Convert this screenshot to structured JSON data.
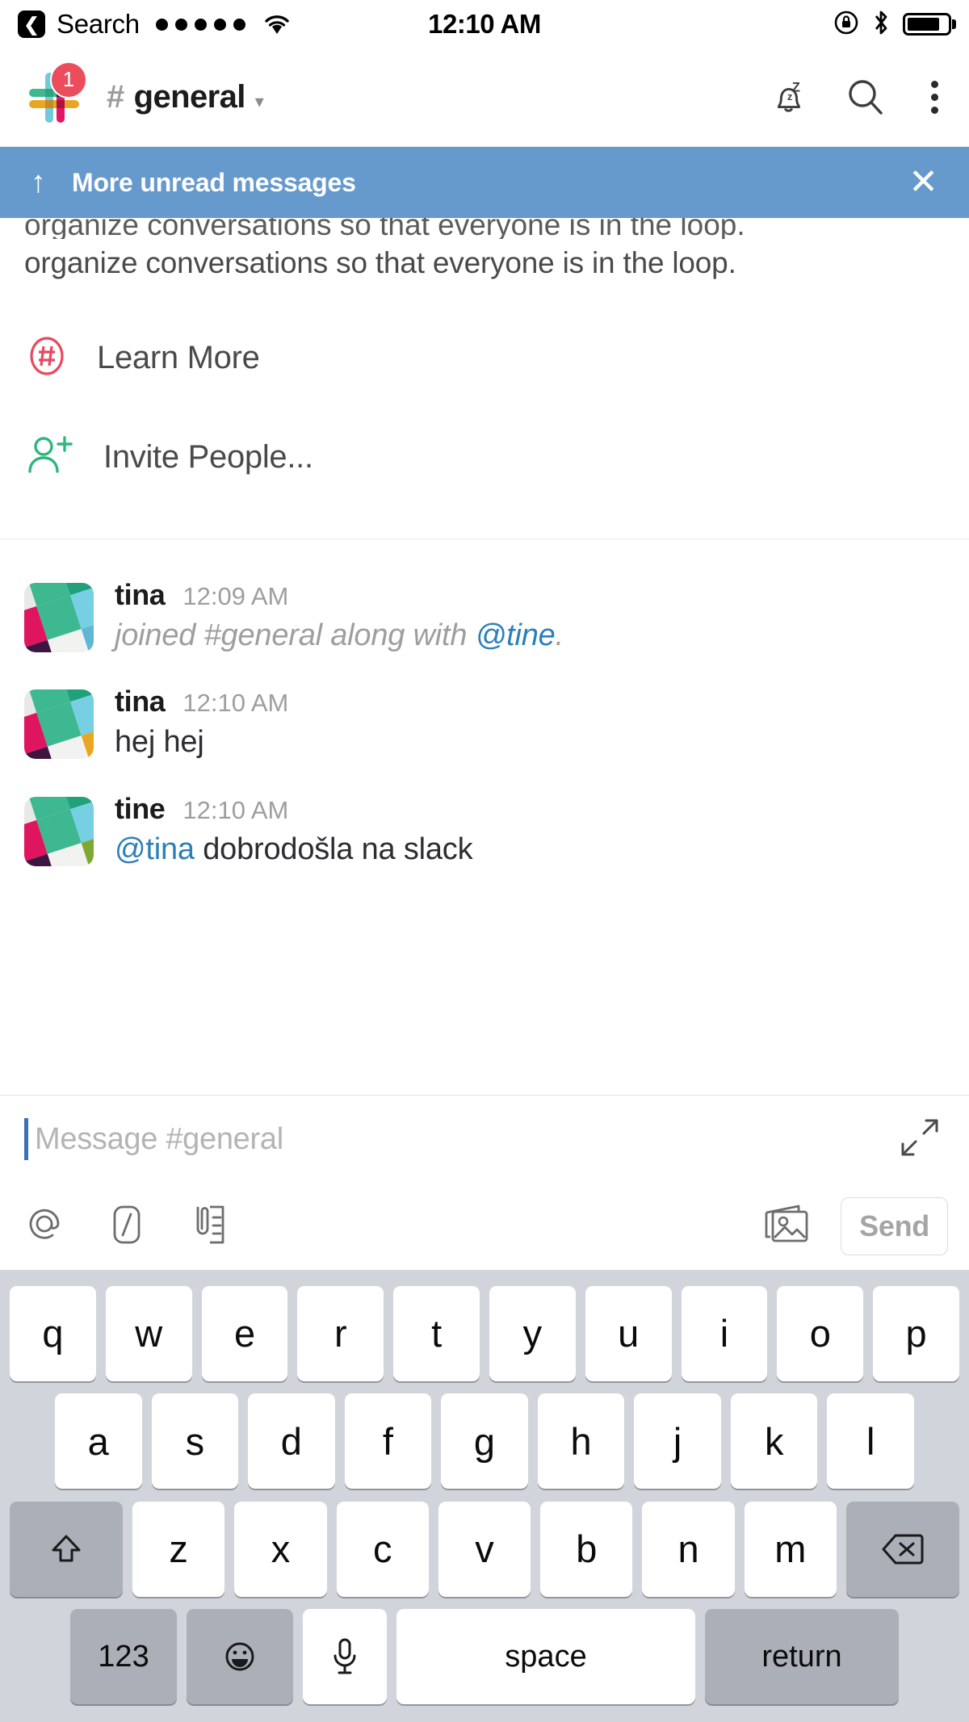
{
  "status_bar": {
    "back_icon": "back-chevron-icon",
    "carrier_label": "Search",
    "signal_icon": "signal-dots-icon",
    "wifi_icon": "wifi-icon",
    "time": "12:10 AM",
    "rotation_lock_icon": "rotation-lock-icon",
    "bluetooth_icon": "bluetooth-icon",
    "battery_icon": "battery-icon"
  },
  "nav_bar": {
    "logo_icon": "slack-logo-icon",
    "badge_count": "1",
    "channel_hash": "#",
    "channel_name": "general",
    "chevron_icon": "chevron-down-icon",
    "dnd_icon": "dnd-sleeping-bell-icon",
    "search_icon": "search-icon",
    "overflow_icon": "overflow-menu-icon"
  },
  "unread_banner": {
    "arrow_icon": "arrow-up-icon",
    "label": "More unread messages",
    "close_icon": "close-icon",
    "background_color": "#6699cc"
  },
  "channel_intro": {
    "clipped_line": "organize conversations so that everyone is in the loop.",
    "text_line": "organize conversations so that everyone is in the loop.",
    "actions": [
      {
        "icon": "hashtag-circle-icon",
        "label": "Learn More",
        "color": "#e8495f"
      },
      {
        "icon": "add-person-icon",
        "label": "Invite People...",
        "color": "#2eb67d"
      }
    ]
  },
  "messages": [
    {
      "avatar": "default-mosaic-avatar",
      "author": "tina",
      "time": "12:09 AM",
      "system": true,
      "text_before": "joined #general along with ",
      "mention": "@tine",
      "text_after": "."
    },
    {
      "avatar": "default-mosaic-avatar",
      "author": "tina",
      "time": "12:10 AM",
      "system": false,
      "text_before": "hej hej",
      "mention": "",
      "text_after": ""
    },
    {
      "avatar": "default-mosaic-avatar",
      "author": "tine",
      "time": "12:10 AM",
      "system": false,
      "text_before": "",
      "mention": "@tina",
      "text_after": " dobrodošla na slack"
    }
  ],
  "composer": {
    "placeholder": "Message #general",
    "expand_icon": "expand-icon",
    "mention_icon": "at-mention-icon",
    "slash_icon": "slash-command-icon",
    "attach_icon": "attachment-icon",
    "photos_icon": "photos-icon",
    "send_label": "Send"
  },
  "keyboard": {
    "row1": [
      "q",
      "w",
      "e",
      "r",
      "t",
      "y",
      "u",
      "i",
      "o",
      "p"
    ],
    "row2": [
      "a",
      "s",
      "d",
      "f",
      "g",
      "h",
      "j",
      "k",
      "l"
    ],
    "row3": [
      "z",
      "x",
      "c",
      "v",
      "b",
      "n",
      "m"
    ],
    "shift_icon": "shift-icon",
    "backspace_icon": "backspace-icon",
    "numbers_label": "123",
    "emoji_icon": "emoji-icon",
    "mic_icon": "microphone-icon",
    "space_label": "space",
    "return_label": "return"
  }
}
